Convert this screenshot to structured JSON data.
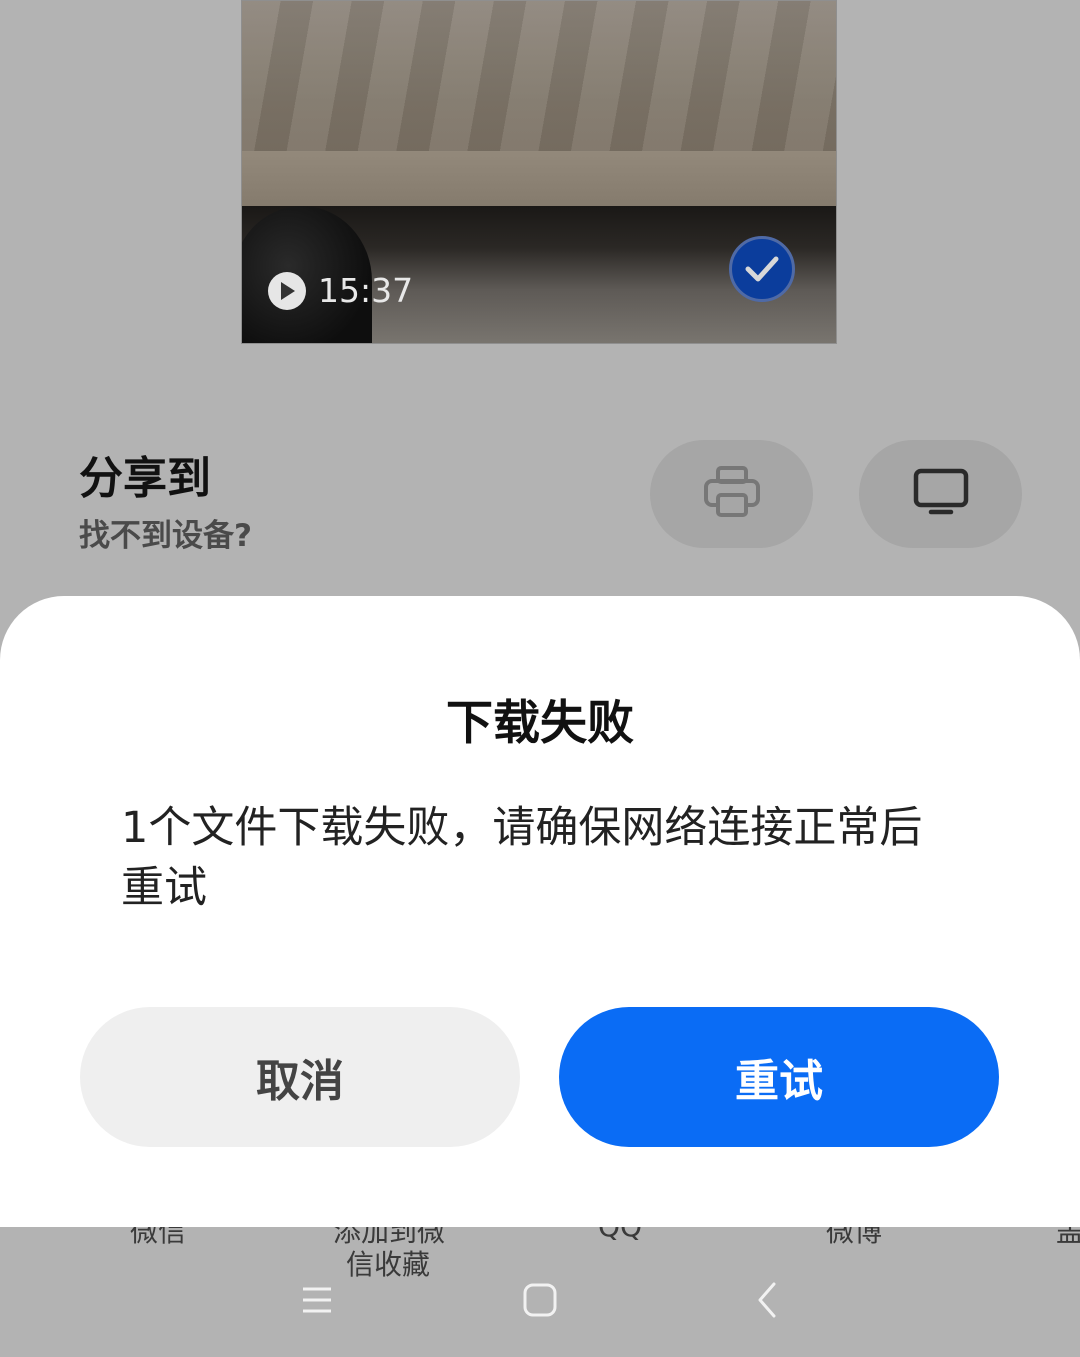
{
  "background": {
    "video_thumbnail": {
      "duration": "15:37",
      "selected": true
    },
    "share": {
      "title": "分享到",
      "subtitle": "找不到设备?"
    },
    "devices": [
      {
        "icon": "printer-icon"
      },
      {
        "icon": "tv-icon"
      }
    ],
    "apps_row": {
      "labels_partial": [
        "微信",
        "添加到微",
        "信收藏",
        "QQ",
        "微博",
        "盖"
      ]
    }
  },
  "dialog": {
    "title": "下载失败",
    "message": "1个文件下载失败，请确保网络连接正常后重试",
    "cancel_label": "取消",
    "retry_label": "重试"
  },
  "nav_bar": {
    "icons": [
      "menu-icon",
      "home-icon",
      "back-icon"
    ]
  },
  "colors": {
    "accent": "#0a6cf5",
    "scrim": "#b3b3b3",
    "selected_check": "#0b3d9c"
  }
}
